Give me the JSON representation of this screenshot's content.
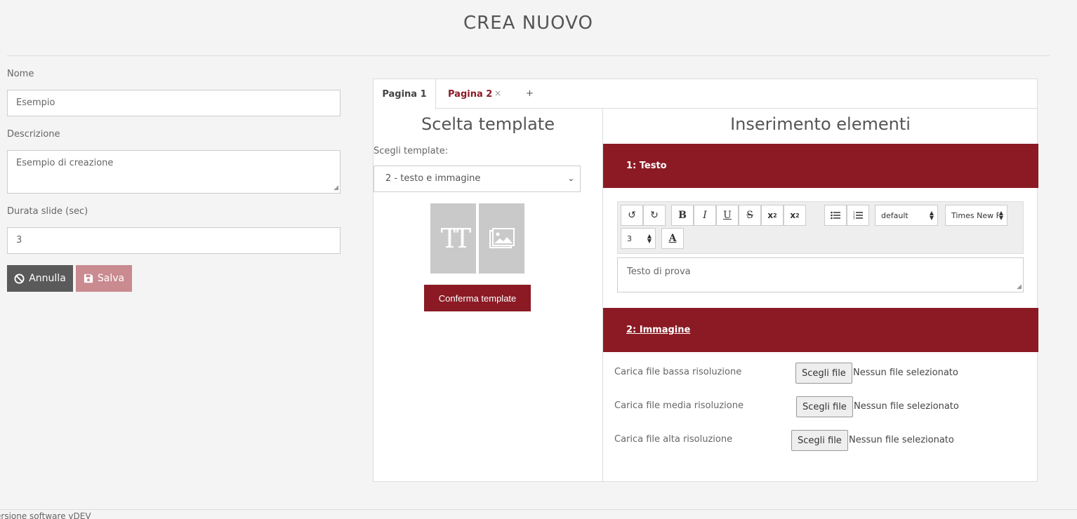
{
  "page": {
    "title": "CREA NUOVO"
  },
  "form": {
    "name_label": "Nome",
    "name_value": "Esempio",
    "desc_label": "Descrizione",
    "desc_value": "Esempio di creazione",
    "duration_label": "Durata slide (sec)",
    "duration_value": "3",
    "cancel_label": "Annulla",
    "save_label": "Salva"
  },
  "tabs": [
    {
      "label": "Pagina 1",
      "active": true
    },
    {
      "label": "Pagina 2",
      "active": false,
      "close": "×"
    }
  ],
  "tab_add": "+",
  "template": {
    "title": "Scelta template",
    "choose_label": "Scegli template:",
    "selected": "2 - testo e immagine",
    "confirm_label": "Conferma template"
  },
  "elements": {
    "title": "Inserimento elementi",
    "item1_title": "1: Testo",
    "item2_title": "2: Immagine",
    "editor": {
      "paragraph_style": "default",
      "font_family": "Times New F",
      "font_size": "3",
      "content": "Testo di prova",
      "buttons": [
        "undo-icon",
        "redo-icon",
        "bold-icon",
        "italic-icon",
        "underline-icon",
        "strikethrough-icon",
        "subscript-icon",
        "superscript-icon",
        "bullet-list-icon",
        "numbered-list-icon",
        "font-color-icon"
      ]
    },
    "uploads": [
      {
        "label": "Carica file bassa risoluzione",
        "button": "Scegli file",
        "status": "Nessun file selezionato"
      },
      {
        "label": "Carica file media risoluzione",
        "button": "Scegli file",
        "status": "Nessun file selezionato"
      },
      {
        "label": "Carica file alta risoluzione",
        "button": "Scegli file",
        "status": "Nessun file selezionato"
      }
    ]
  },
  "footer": {
    "version": "ersione software vDEV"
  },
  "colors": {
    "brand": "#8b1a24",
    "cancel_bg": "#5a5a5a",
    "save_bg": "#c98a90",
    "page_bg": "#f4f4f4"
  }
}
